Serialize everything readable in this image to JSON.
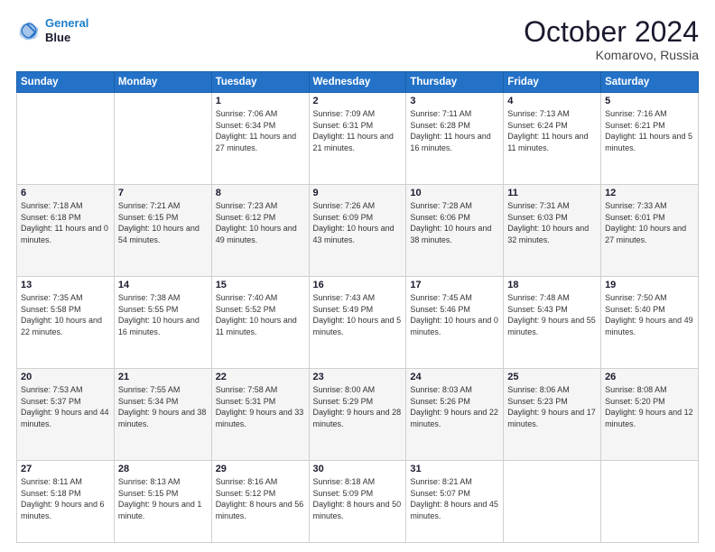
{
  "header": {
    "logo_line1": "General",
    "logo_line2": "Blue",
    "title": "October 2024",
    "location": "Komarovo, Russia"
  },
  "weekdays": [
    "Sunday",
    "Monday",
    "Tuesday",
    "Wednesday",
    "Thursday",
    "Friday",
    "Saturday"
  ],
  "weeks": [
    [
      {
        "day": "",
        "info": ""
      },
      {
        "day": "",
        "info": ""
      },
      {
        "day": "1",
        "info": "Sunrise: 7:06 AM\nSunset: 6:34 PM\nDaylight: 11 hours and 27 minutes."
      },
      {
        "day": "2",
        "info": "Sunrise: 7:09 AM\nSunset: 6:31 PM\nDaylight: 11 hours and 21 minutes."
      },
      {
        "day": "3",
        "info": "Sunrise: 7:11 AM\nSunset: 6:28 PM\nDaylight: 11 hours and 16 minutes."
      },
      {
        "day": "4",
        "info": "Sunrise: 7:13 AM\nSunset: 6:24 PM\nDaylight: 11 hours and 11 minutes."
      },
      {
        "day": "5",
        "info": "Sunrise: 7:16 AM\nSunset: 6:21 PM\nDaylight: 11 hours and 5 minutes."
      }
    ],
    [
      {
        "day": "6",
        "info": "Sunrise: 7:18 AM\nSunset: 6:18 PM\nDaylight: 11 hours and 0 minutes."
      },
      {
        "day": "7",
        "info": "Sunrise: 7:21 AM\nSunset: 6:15 PM\nDaylight: 10 hours and 54 minutes."
      },
      {
        "day": "8",
        "info": "Sunrise: 7:23 AM\nSunset: 6:12 PM\nDaylight: 10 hours and 49 minutes."
      },
      {
        "day": "9",
        "info": "Sunrise: 7:26 AM\nSunset: 6:09 PM\nDaylight: 10 hours and 43 minutes."
      },
      {
        "day": "10",
        "info": "Sunrise: 7:28 AM\nSunset: 6:06 PM\nDaylight: 10 hours and 38 minutes."
      },
      {
        "day": "11",
        "info": "Sunrise: 7:31 AM\nSunset: 6:03 PM\nDaylight: 10 hours and 32 minutes."
      },
      {
        "day": "12",
        "info": "Sunrise: 7:33 AM\nSunset: 6:01 PM\nDaylight: 10 hours and 27 minutes."
      }
    ],
    [
      {
        "day": "13",
        "info": "Sunrise: 7:35 AM\nSunset: 5:58 PM\nDaylight: 10 hours and 22 minutes."
      },
      {
        "day": "14",
        "info": "Sunrise: 7:38 AM\nSunset: 5:55 PM\nDaylight: 10 hours and 16 minutes."
      },
      {
        "day": "15",
        "info": "Sunrise: 7:40 AM\nSunset: 5:52 PM\nDaylight: 10 hours and 11 minutes."
      },
      {
        "day": "16",
        "info": "Sunrise: 7:43 AM\nSunset: 5:49 PM\nDaylight: 10 hours and 5 minutes."
      },
      {
        "day": "17",
        "info": "Sunrise: 7:45 AM\nSunset: 5:46 PM\nDaylight: 10 hours and 0 minutes."
      },
      {
        "day": "18",
        "info": "Sunrise: 7:48 AM\nSunset: 5:43 PM\nDaylight: 9 hours and 55 minutes."
      },
      {
        "day": "19",
        "info": "Sunrise: 7:50 AM\nSunset: 5:40 PM\nDaylight: 9 hours and 49 minutes."
      }
    ],
    [
      {
        "day": "20",
        "info": "Sunrise: 7:53 AM\nSunset: 5:37 PM\nDaylight: 9 hours and 44 minutes."
      },
      {
        "day": "21",
        "info": "Sunrise: 7:55 AM\nSunset: 5:34 PM\nDaylight: 9 hours and 38 minutes."
      },
      {
        "day": "22",
        "info": "Sunrise: 7:58 AM\nSunset: 5:31 PM\nDaylight: 9 hours and 33 minutes."
      },
      {
        "day": "23",
        "info": "Sunrise: 8:00 AM\nSunset: 5:29 PM\nDaylight: 9 hours and 28 minutes."
      },
      {
        "day": "24",
        "info": "Sunrise: 8:03 AM\nSunset: 5:26 PM\nDaylight: 9 hours and 22 minutes."
      },
      {
        "day": "25",
        "info": "Sunrise: 8:06 AM\nSunset: 5:23 PM\nDaylight: 9 hours and 17 minutes."
      },
      {
        "day": "26",
        "info": "Sunrise: 8:08 AM\nSunset: 5:20 PM\nDaylight: 9 hours and 12 minutes."
      }
    ],
    [
      {
        "day": "27",
        "info": "Sunrise: 8:11 AM\nSunset: 5:18 PM\nDaylight: 9 hours and 6 minutes."
      },
      {
        "day": "28",
        "info": "Sunrise: 8:13 AM\nSunset: 5:15 PM\nDaylight: 9 hours and 1 minute."
      },
      {
        "day": "29",
        "info": "Sunrise: 8:16 AM\nSunset: 5:12 PM\nDaylight: 8 hours and 56 minutes."
      },
      {
        "day": "30",
        "info": "Sunrise: 8:18 AM\nSunset: 5:09 PM\nDaylight: 8 hours and 50 minutes."
      },
      {
        "day": "31",
        "info": "Sunrise: 8:21 AM\nSunset: 5:07 PM\nDaylight: 8 hours and 45 minutes."
      },
      {
        "day": "",
        "info": ""
      },
      {
        "day": "",
        "info": ""
      }
    ]
  ]
}
